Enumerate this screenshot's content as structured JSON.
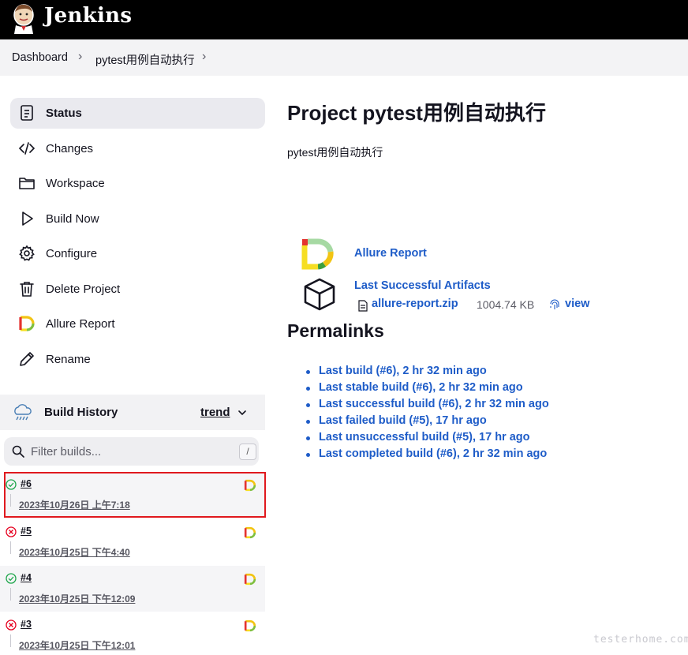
{
  "header": {
    "brand": "Jenkins"
  },
  "breadcrumb": {
    "items": [
      "Dashboard",
      "pytest用例自动执行"
    ]
  },
  "sidebar": {
    "items": [
      {
        "label": "Status",
        "icon": "status-icon"
      },
      {
        "label": "Changes",
        "icon": "code-icon"
      },
      {
        "label": "Workspace",
        "icon": "folder-icon"
      },
      {
        "label": "Build Now",
        "icon": "play-icon"
      },
      {
        "label": "Configure",
        "icon": "gear-icon"
      },
      {
        "label": "Delete Project",
        "icon": "trash-icon"
      },
      {
        "label": "Allure Report",
        "icon": "allure-icon"
      },
      {
        "label": "Rename",
        "icon": "pencil-icon"
      }
    ]
  },
  "build_history": {
    "title": "Build History",
    "trend_label": "trend",
    "filter_placeholder": "Filter builds...",
    "filter_shortcut": "/",
    "builds": [
      {
        "number": "#6",
        "date": "2023年10月26日 上午7:18",
        "status": "success"
      },
      {
        "number": "#5",
        "date": "2023年10月25日 下午4:40",
        "status": "failed"
      },
      {
        "number": "#4",
        "date": "2023年10月25日 下午12:09",
        "status": "success"
      },
      {
        "number": "#3",
        "date": "2023年10月25日 下午12:01",
        "status": "failed"
      }
    ]
  },
  "main": {
    "title": "Project pytest用例自动执行",
    "description": "pytest用例自动执行",
    "allure_report_label": "Allure Report",
    "last_artifacts_label": "Last Successful Artifacts",
    "artifact_name": "allure-report.zip",
    "artifact_size": "1004.74 KB",
    "view_label": "view",
    "permalinks_title": "Permalinks",
    "permalinks": [
      "Last build (#6), 2 hr 32 min ago",
      "Last stable build (#6), 2 hr 32 min ago",
      "Last successful build (#6), 2 hr 32 min ago",
      "Last failed build (#5), 17 hr ago",
      "Last unsuccessful build (#5), 17 hr ago",
      "Last completed build (#6), 2 hr 32 min ago"
    ]
  },
  "watermark": "testerhome.com",
  "colors": {
    "link": "#1e5cc8",
    "success": "#1ea64b",
    "failure": "#e6001f",
    "highlight_border": "#e0191e"
  }
}
